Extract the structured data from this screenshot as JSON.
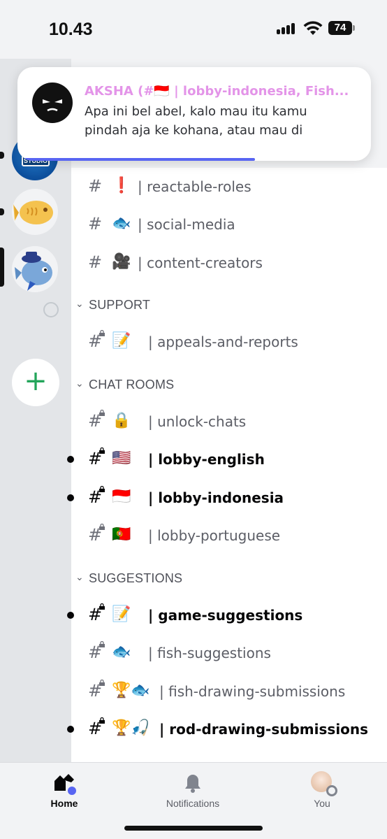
{
  "status_bar": {
    "time": "10.43",
    "battery": "74"
  },
  "notification": {
    "title": "AKSHA (#🇮🇩 | lobby-indonesia, Fish...",
    "body": "Apa ini bel abel, kalo mau itu kamu pindah aja ke kohana, atau mau di"
  },
  "servers": [
    {
      "name": "studio-server",
      "badge_text": "STUDIO"
    },
    {
      "name": "taiyaki-server",
      "emoji": "🐟"
    },
    {
      "name": "fish-game-server",
      "emoji": "🐡"
    }
  ],
  "add_server": {
    "label": "+"
  },
  "channels_top": [
    {
      "emoji": "❗",
      "name": "| reactable-roles"
    },
    {
      "emoji": "🐟",
      "name": "| social-media"
    },
    {
      "emoji": "🎥",
      "name": "| content-creators"
    }
  ],
  "categories": {
    "support": "SUPPORT",
    "chat_rooms": "CHAT ROOMS",
    "suggestions": "SUGGESTIONS"
  },
  "support_channels": [
    {
      "emoji": "📝",
      "name": "| appeals-and-reports"
    }
  ],
  "chat_channels": [
    {
      "emoji": "🔒",
      "name": "| unlock-chats",
      "unread": false
    },
    {
      "emoji": "🇺🇸",
      "name": "| lobby-english",
      "unread": true
    },
    {
      "emoji": "🇮🇩",
      "name": "| lobby-indonesia",
      "unread": true
    },
    {
      "emoji": "🇵🇹",
      "name": "| lobby-portuguese",
      "unread": false
    }
  ],
  "suggestion_channels": [
    {
      "emoji": "📝",
      "name": "| game-suggestions",
      "unread": true
    },
    {
      "emoji": "🐟",
      "name": "| fish-suggestions",
      "unread": false
    },
    {
      "emoji": "🏆🐟",
      "name": "| fish-drawing-submissions",
      "unread": false
    },
    {
      "emoji": "🏆🎣",
      "name": "| rod-drawing-submissions",
      "unread": true
    }
  ],
  "tabs": {
    "home": "Home",
    "notifications": "Notifications",
    "you": "You"
  },
  "colors": {
    "accent": "#5865f2",
    "notification_title": "#e394e8",
    "add_green": "#23a55a"
  }
}
